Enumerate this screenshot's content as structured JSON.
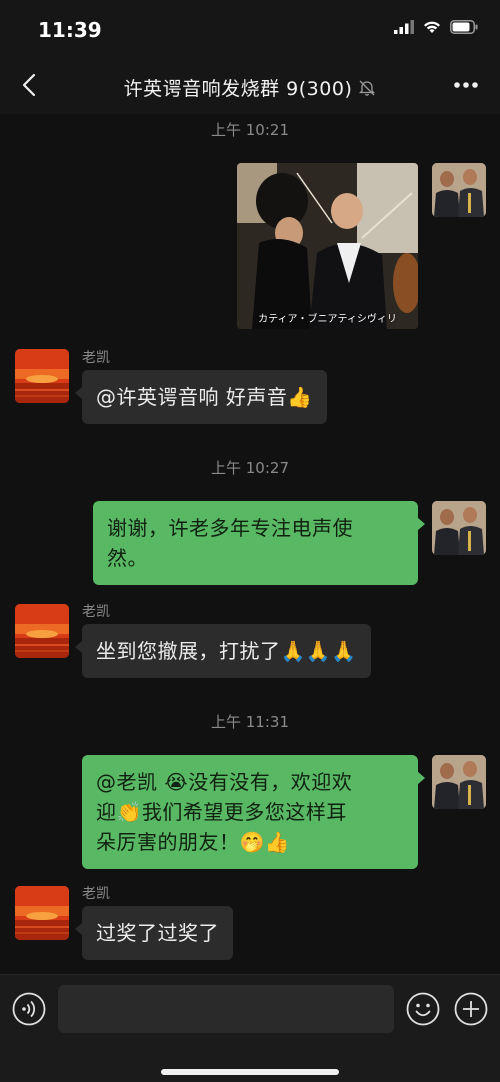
{
  "status": {
    "time": "11:39"
  },
  "nav": {
    "title": "许英谔音响发烧群 9(300)",
    "muted_icon": "bell-slash-icon",
    "back_icon": "chevron-left-icon",
    "more_icon": "more-dots-icon"
  },
  "messages": {
    "ts1": "上午 10:21",
    "image_caption": "カティア・ブニアティシヴィリ",
    "sender2": "老凯",
    "text2": "@许英谔音响 好声音👍",
    "ts2": "上午 10:27",
    "text3_line1": "谢谢，许老多年专注电声使",
    "text3_line2": "然。",
    "sender4": "老凯",
    "text4": "坐到您撤展，打扰了🙏🙏🙏",
    "ts3": "上午 11:31",
    "text5_line1": "@老凯 😭没有没有，欢迎欢",
    "text5_line2": "迎👏我们希望更多您这样耳",
    "text5_line3": "朵厉害的朋友！🤭👍",
    "sender6": "老凯",
    "text6": "过奖了过奖了"
  },
  "input": {
    "placeholder": ""
  },
  "colors": {
    "background": "#111111",
    "bubble_out": "#58b864",
    "bubble_in": "#2c2c2c"
  }
}
